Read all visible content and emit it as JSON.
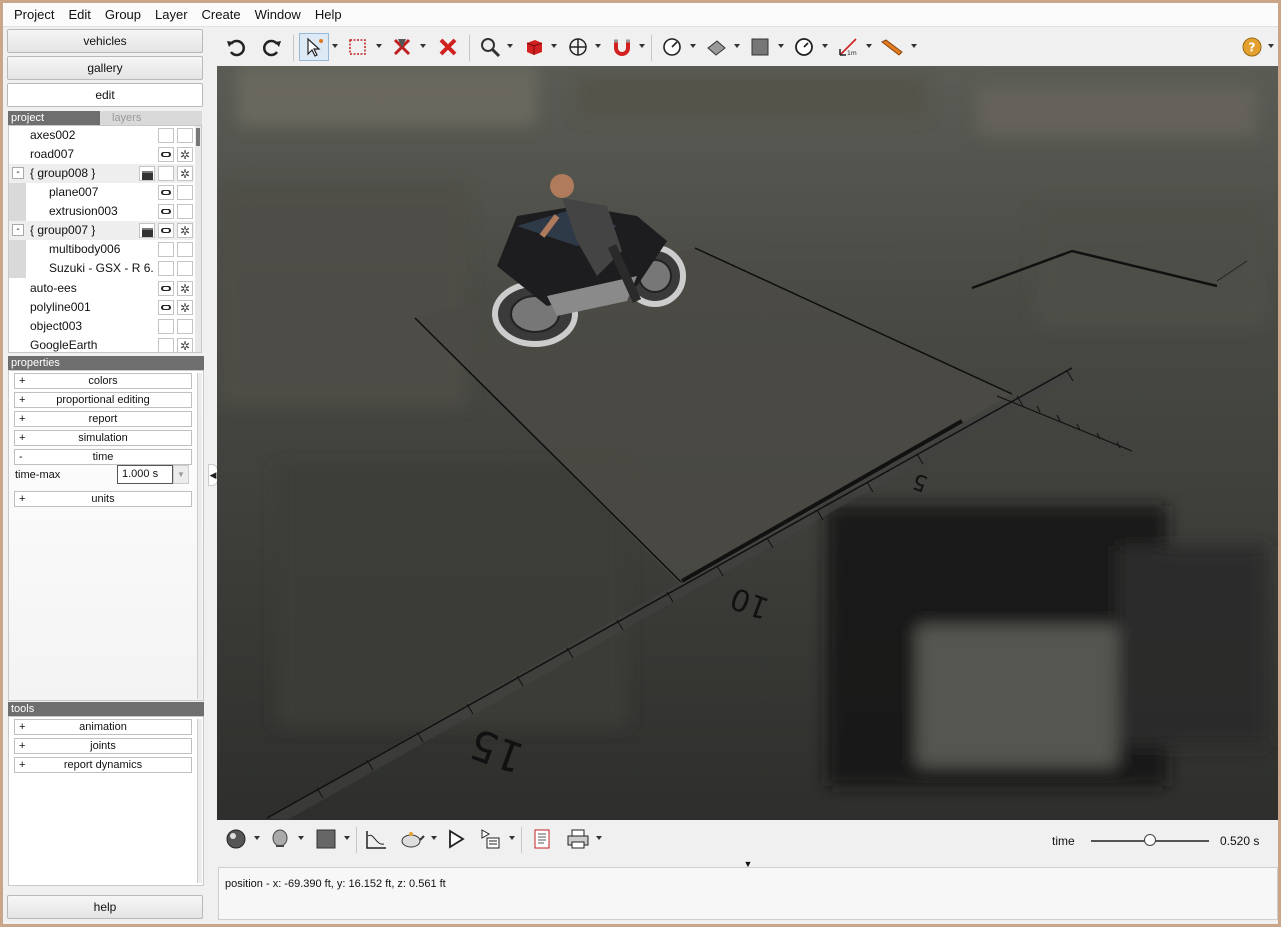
{
  "menubar": {
    "items": [
      "Project",
      "Edit",
      "Group",
      "Layer",
      "Create",
      "Window",
      "Help"
    ]
  },
  "left_panel": {
    "nav": {
      "vehicles": "vehicles",
      "gallery": "gallery",
      "edit": "edit"
    },
    "tabs": {
      "project": "project",
      "layers": "layers"
    },
    "tree": [
      {
        "label": "axes002",
        "indent": 0,
        "visible": false,
        "selectable": false
      },
      {
        "label": "road007",
        "indent": 0,
        "visible": true,
        "selectable": true
      },
      {
        "label": "{ group008 }",
        "group": true,
        "toggle": "-",
        "folder": true,
        "visible": false,
        "selectable": true
      },
      {
        "label": "plane007",
        "indent": 1,
        "visible": true,
        "selectable": false
      },
      {
        "label": "extrusion003",
        "indent": 1,
        "visible": true,
        "selectable": false
      },
      {
        "label": "{ group007 }",
        "group": true,
        "toggle": "-",
        "folder": true,
        "visible": true,
        "selectable": true
      },
      {
        "label": "multibody006",
        "indent": 1,
        "visible": false,
        "selectable": false
      },
      {
        "label": "Suzuki - GSX - R 6...",
        "indent": 1,
        "visible": false,
        "selectable": false
      },
      {
        "label": "auto-ees",
        "indent": 0,
        "visible": true,
        "selectable": true
      },
      {
        "label": "polyline001",
        "indent": 0,
        "visible": true,
        "selectable": true
      },
      {
        "label": "object003",
        "indent": 0,
        "visible": false,
        "selectable": false
      },
      {
        "label": "GoogleEarth",
        "indent": 0,
        "visible": false,
        "selectable": true
      }
    ],
    "properties": {
      "header": "properties",
      "rows": [
        {
          "toggle": "+",
          "label": "colors"
        },
        {
          "toggle": "+",
          "label": "proportional editing"
        },
        {
          "toggle": "+",
          "label": "report"
        },
        {
          "toggle": "+",
          "label": "simulation"
        },
        {
          "toggle": "-",
          "label": "time"
        }
      ],
      "time_max_label": "time-max",
      "time_max_value": "1.000 s",
      "units": {
        "toggle": "+",
        "label": "units"
      }
    },
    "tools": {
      "header": "tools",
      "rows": [
        {
          "toggle": "+",
          "label": "animation"
        },
        {
          "toggle": "+",
          "label": "joints"
        },
        {
          "toggle": "+",
          "label": "report dynamics"
        }
      ]
    },
    "help": "help"
  },
  "toolbar_top": {
    "icons": [
      "undo-icon",
      "redo-icon",
      "select-arrow-icon",
      "select-box-icon",
      "delete-selected-icon",
      "delete-icon",
      "zoom-icon",
      "solid-cube-icon",
      "move-icon",
      "magnet-icon",
      "dial-icon",
      "plane-icon",
      "square-icon",
      "gauge-icon",
      "measure-1m-icon",
      "ruler-icon",
      "help-icon"
    ]
  },
  "viewport": {
    "ruler_labels": [
      "5",
      "10",
      "15"
    ]
  },
  "toolbar_bottom": {
    "time_label": "time",
    "time_value": "0.520 s",
    "time_fraction": 0.5
  },
  "status": {
    "position_text": "position - x: -69.390 ft, y: 16.152 ft, z: 0.561 ft"
  },
  "colors": {
    "section_header": "#6e6e6e",
    "accent_red": "#d21f1f",
    "window_border": "#c9a58a"
  }
}
